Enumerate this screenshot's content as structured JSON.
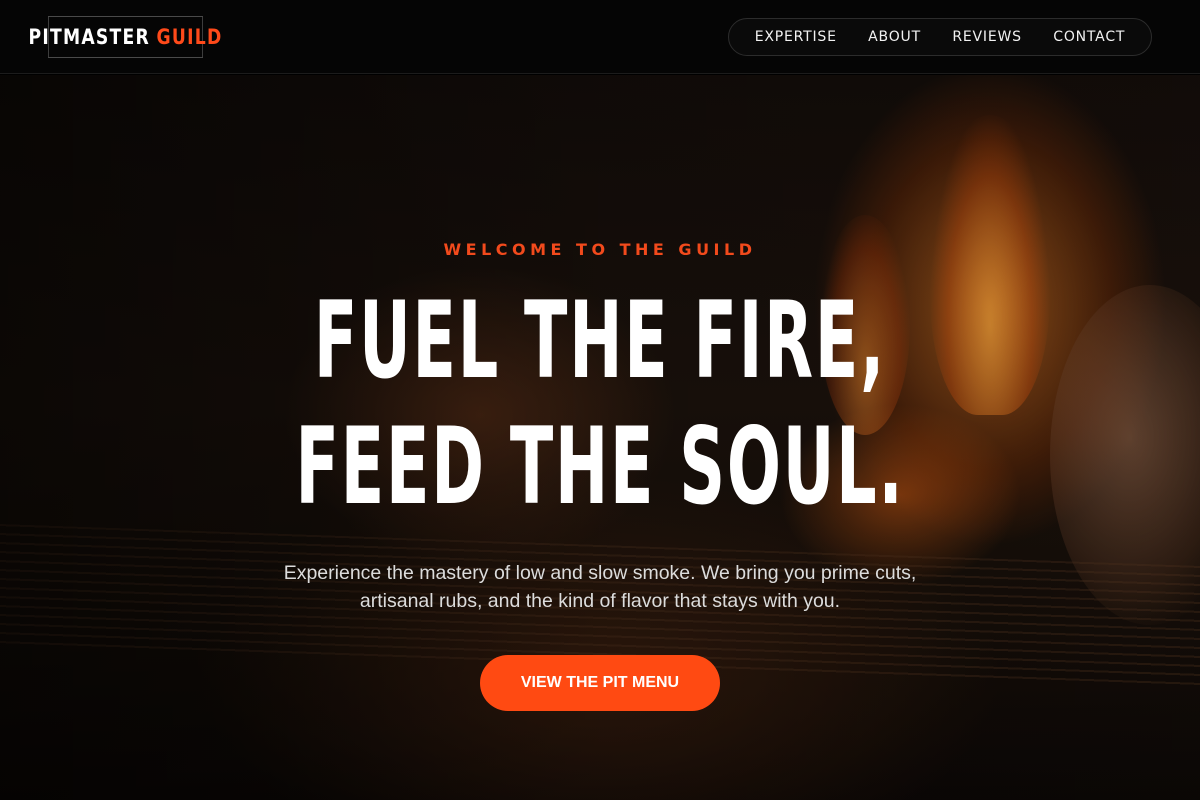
{
  "brand": {
    "word1": "PITMASTER",
    "word2": "GUILD"
  },
  "nav": {
    "items": [
      {
        "label": "EXPERTISE"
      },
      {
        "label": "ABOUT"
      },
      {
        "label": "REVIEWS"
      },
      {
        "label": "CONTACT"
      }
    ]
  },
  "hero": {
    "eyebrow": "WELCOME TO THE GUILD",
    "headline_line1": "FUEL THE FIRE,",
    "headline_line2": "FEED THE SOUL.",
    "lead": "Experience the mastery of low and slow smoke. We bring you prime cuts, artisanal rubs, and the kind of flavor that stays with you.",
    "cta_label": "VIEW THE PIT MENU"
  },
  "colors": {
    "accent": "#ff4a12",
    "background": "#050505",
    "text": "#ffffff"
  }
}
